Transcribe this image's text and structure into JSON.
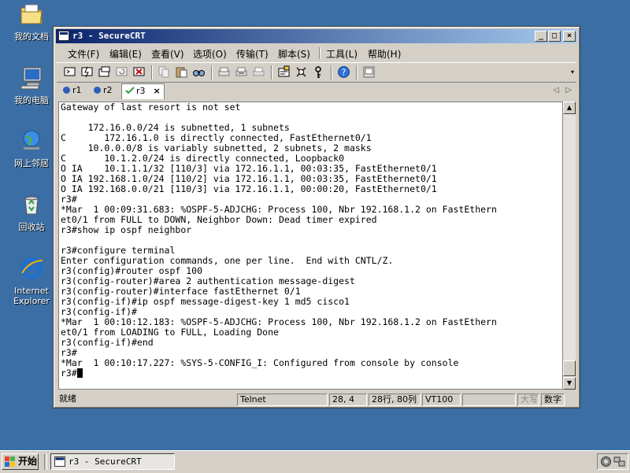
{
  "desktop": {
    "icons": [
      {
        "label": "我的文档",
        "icon": "my-documents-icon"
      },
      {
        "label": "我的电脑",
        "icon": "my-computer-icon"
      },
      {
        "label": "网上邻居",
        "icon": "network-places-icon"
      },
      {
        "label": "回收站",
        "icon": "recycle-bin-icon"
      },
      {
        "label": "Internet Explorer",
        "icon": "internet-explorer-icon"
      }
    ]
  },
  "window": {
    "title": "r3 - SecureCRT",
    "controls": {
      "minimize": "_",
      "maximize": "□",
      "close": "×"
    }
  },
  "menu": {
    "items": [
      "文件(F)",
      "编辑(E)",
      "查看(V)",
      "选项(O)",
      "传输(T)",
      "脚本(S)",
      "工具(L)",
      "帮助(H)"
    ]
  },
  "toolbar": {
    "tools": [
      "connect-icon",
      "quick-connect-icon",
      "connect-tab-icon",
      "reconnect-icon",
      "disconnect-icon",
      "copy-icon",
      "paste-icon",
      "find-icon",
      "print-icon",
      "print-selection-icon",
      "print-setup-icon",
      "session-options-icon",
      "global-options-icon",
      "keymap-icon",
      "help-icon",
      "about-icon"
    ]
  },
  "tabs": [
    {
      "label": "r1",
      "status": "info"
    },
    {
      "label": "r2",
      "status": "info"
    },
    {
      "label": "r3",
      "status": "connected",
      "close": "×"
    }
  ],
  "tab_nav": {
    "prev": "◁",
    "next": "▷"
  },
  "terminal": {
    "lines": [
      "Gateway of last resort is not set",
      "",
      "     172.16.0.0/24 is subnetted, 1 subnets",
      "C       172.16.1.0 is directly connected, FastEthernet0/1",
      "     10.0.0.0/8 is variably subnetted, 2 subnets, 2 masks",
      "C       10.1.2.0/24 is directly connected, Loopback0",
      "O IA    10.1.1.1/32 [110/3] via 172.16.1.1, 00:03:35, FastEthernet0/1",
      "O IA 192.168.1.0/24 [110/2] via 172.16.1.1, 00:03:35, FastEthernet0/1",
      "O IA 192.168.0.0/21 [110/3] via 172.16.1.1, 00:00:20, FastEthernet0/1",
      "r3#",
      "*Mar  1 00:09:31.683: %OSPF-5-ADJCHG: Process 100, Nbr 192.168.1.2 on FastEthern",
      "et0/1 from FULL to DOWN, Neighbor Down: Dead timer expired",
      "r3#show ip ospf neighbor",
      "",
      "r3#configure terminal",
      "Enter configuration commands, one per line.  End with CNTL/Z.",
      "r3(config)#router ospf 100",
      "r3(config-router)#area 2 authentication message-digest",
      "r3(config-router)#interface fastEthernet 0/1",
      "r3(config-if)#ip ospf message-digest-key 1 md5 cisco1",
      "r3(config-if)#",
      "*Mar  1 00:10:12.183: %OSPF-5-ADJCHG: Process 100, Nbr 192.168.1.2 on FastEthern",
      "et0/1 from LOADING to FULL, Loading Done",
      "r3(config-if)#end",
      "r3#",
      "*Mar  1 00:10:17.227: %SYS-5-CONFIG_I: Configured from console by console"
    ],
    "prompt": "r3#"
  },
  "scrollbar": {
    "up": "▲",
    "down": "▼"
  },
  "status": {
    "ready": "就绪",
    "protocol": "Telnet",
    "cursor_pos": "28,  4",
    "size": "28行, 80列",
    "emulation": "VT100",
    "caps": "大写",
    "num": "数字"
  },
  "taskbar": {
    "start_label": "开始",
    "task_label": "r3 - SecureCRT"
  }
}
